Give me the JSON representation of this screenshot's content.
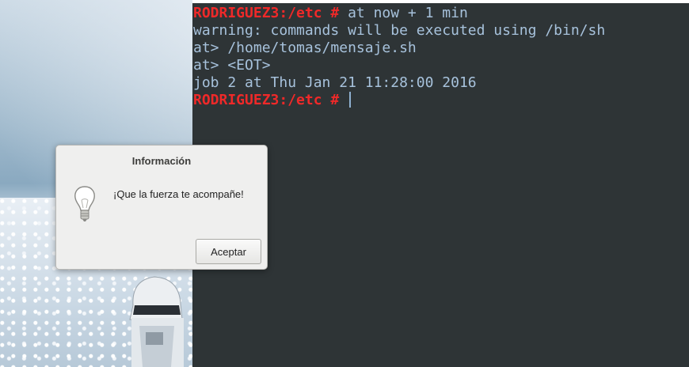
{
  "terminal": {
    "lines": [
      {
        "prompt": "RODRIGUEZ3:/etc # ",
        "text": "at now + 1 min"
      },
      {
        "prompt": "",
        "text": "warning: commands will be executed using /bin/sh"
      },
      {
        "prompt": "",
        "text": "at> /home/tomas/mensaje.sh"
      },
      {
        "prompt": "",
        "text": "at> <EOT>"
      },
      {
        "prompt": "",
        "text": "job 2 at Thu Jan 21 11:28:00 2016"
      },
      {
        "prompt": "RODRIGUEZ3:/etc # ",
        "text": ""
      }
    ],
    "colors": {
      "background": "#2e3436",
      "text": "#a7c2dc",
      "prompt": "#ef2929"
    }
  },
  "dialog": {
    "title": "Información",
    "icon": "lightbulb-icon",
    "message": "¡Que la fuerza te acompañe!",
    "ok_label": "Aceptar"
  }
}
